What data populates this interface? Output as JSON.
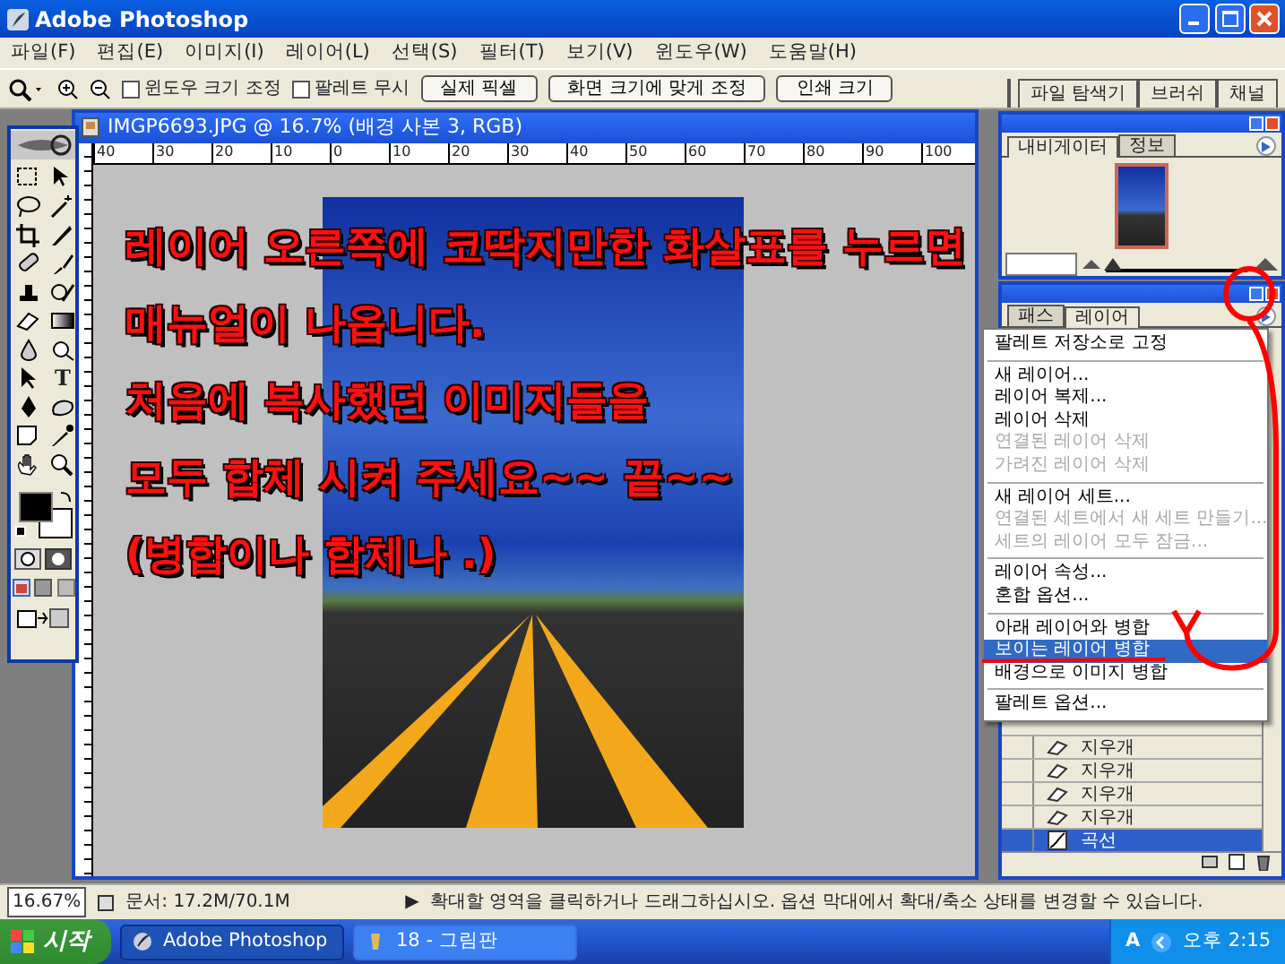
{
  "window": {
    "title": "Adobe Photoshop"
  },
  "menu": [
    "파일(F)",
    "편집(E)",
    "이미지(I)",
    "레이어(L)",
    "선택(S)",
    "필터(T)",
    "보기(V)",
    "윈도우(W)",
    "도움말(H)"
  ],
  "options_bar": {
    "checkboxes": [
      {
        "label": "윈도우 크기 조정",
        "checked": false
      },
      {
        "label": "팔레트 무시",
        "checked": false
      }
    ],
    "buttons": [
      "실제 픽셀",
      "화면 크기에 맞게 조정",
      "인쇄 크기"
    ],
    "palette_well_tabs": [
      "파일 탐색기",
      "브러쉬",
      "채널"
    ]
  },
  "toolbox": {
    "type_tool_glyph": "T"
  },
  "document": {
    "title": "IMGP6693.JPG @ 16.7% (배경 사본 3, RGB)",
    "ruler_labels": [
      "40",
      "30",
      "20",
      "10",
      "0",
      "10",
      "20",
      "30",
      "40",
      "50",
      "60",
      "70",
      "80",
      "90",
      "100"
    ]
  },
  "navigator": {
    "tabs": [
      {
        "label": "내비게이터",
        "selected": true
      },
      {
        "label": "정보",
        "selected": false
      }
    ],
    "zoom_slider": {
      "level": 0.05
    }
  },
  "layers_palette": {
    "tabs": [
      {
        "label": "패스",
        "selected": false
      },
      {
        "label": "레이어",
        "selected": true
      }
    ],
    "rows": [
      {
        "kind": "eraser",
        "label": "지우개",
        "selected": false
      },
      {
        "kind": "eraser",
        "label": "지우개",
        "selected": false
      },
      {
        "kind": "eraser",
        "label": "지우개",
        "selected": false
      },
      {
        "kind": "eraser",
        "label": "지우개",
        "selected": false
      },
      {
        "kind": "curves",
        "label": "곡선",
        "selected": true
      }
    ]
  },
  "palette_menu": {
    "items": [
      {
        "kind": "item",
        "label": "팔레트 저장소로 고정",
        "disabled": false,
        "selected": false
      },
      {
        "kind": "separator"
      },
      {
        "kind": "item",
        "label": "새 레이어...",
        "disabled": false,
        "selected": false
      },
      {
        "kind": "item",
        "label": "레이어 복제...",
        "disabled": false,
        "selected": false
      },
      {
        "kind": "item",
        "label": "레이어 삭제",
        "disabled": false,
        "selected": false
      },
      {
        "kind": "item",
        "label": "연결된 레이어 삭제",
        "disabled": true,
        "selected": false
      },
      {
        "kind": "item",
        "label": "가려진 레이어 삭제",
        "disabled": true,
        "selected": false
      },
      {
        "kind": "separator"
      },
      {
        "kind": "item",
        "label": "새 레이어 세트...",
        "disabled": false,
        "selected": false
      },
      {
        "kind": "item",
        "label": "연결된 세트에서 새 세트 만들기...",
        "disabled": true,
        "selected": false
      },
      {
        "kind": "item",
        "label": "세트의 레이어 모두 잠금...",
        "disabled": true,
        "selected": false
      },
      {
        "kind": "separator"
      },
      {
        "kind": "item",
        "label": "레이어 속성...",
        "disabled": false,
        "selected": false
      },
      {
        "kind": "item",
        "label": "혼합 옵션...",
        "disabled": false,
        "selected": false
      },
      {
        "kind": "separator"
      },
      {
        "kind": "item",
        "label": "아래 레이어와 병합",
        "disabled": false,
        "selected": false
      },
      {
        "kind": "item",
        "label": "보이는 레이어 병합",
        "disabled": false,
        "selected": true
      },
      {
        "kind": "item",
        "label": "배경으로 이미지 병합",
        "disabled": false,
        "selected": false
      },
      {
        "kind": "separator"
      },
      {
        "kind": "item",
        "label": "팔레트 옵션...",
        "disabled": false,
        "selected": false
      }
    ]
  },
  "annotation": {
    "lines": [
      "레이어 오른쪽에 코딱지만한 화살표를 누르면",
      "매뉴얼이 나옵니다.",
      "처음에 복사했던 이미지들을",
      "모두 합체 시켜 주세요~~ 끝~~",
      "(병합이나 합체나 .)"
    ]
  },
  "status_bar": {
    "zoom": "16.67%",
    "doc_info": "문서: 17.2M/70.1M",
    "arrow": "▶",
    "message": "확대할 영역을 클릭하거나 드래그하십시오. 옵션 막대에서 확대/축소 상태를 변경할 수 있습니다."
  },
  "taskbar": {
    "start": "시작",
    "tasks": [
      {
        "label": "Adobe Photoshop",
        "selected": true
      },
      {
        "label": "18 - 그림판",
        "selected": false
      }
    ],
    "tray_glyph": "A",
    "clock": "오후 2:15"
  }
}
